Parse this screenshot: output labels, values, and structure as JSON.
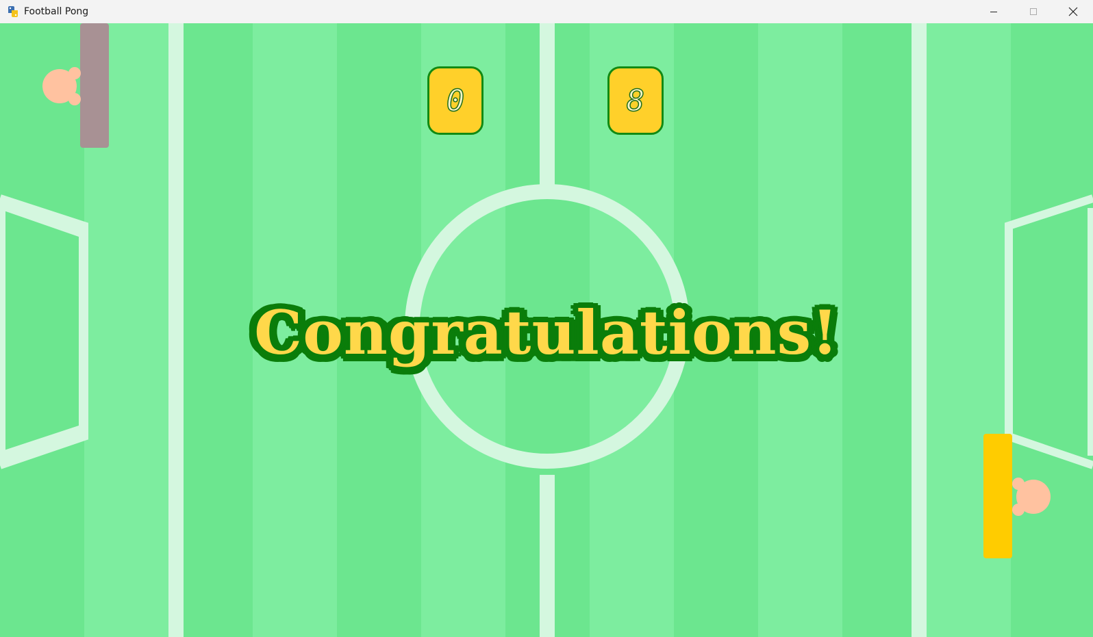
{
  "window": {
    "title": "Football Pong",
    "app_icon": "python-snake-icon",
    "controls": [
      "minimize-icon",
      "maximize-icon",
      "close-icon"
    ]
  },
  "game": {
    "score_left": "0",
    "score_right": "8",
    "message": "Congratulations!",
    "left_paddle_color": "#a89194",
    "right_paddle_color": "#ffcc00",
    "player_color": "#ffc2a0",
    "field_stripe_light": "#7ded9f",
    "field_stripe_dark": "#6ce68f",
    "line_color": "#d4f7df",
    "score_box_color": "#ffd02a",
    "score_border_color": "#138a13",
    "message_fill_color": "#ffd84a",
    "message_outline_color": "#0a7d0a"
  }
}
